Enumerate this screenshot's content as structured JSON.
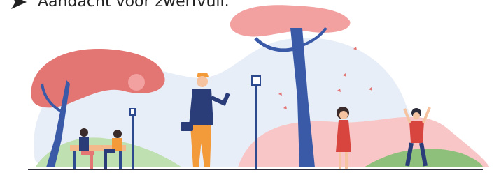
{
  "bullet": {
    "text": "Aandacht voor zwerfvuil.",
    "icon": "arrow-bullet-icon"
  },
  "illustration": {
    "subject": "park-scene",
    "colors": {
      "tree_trunk": "#3a5aa8",
      "tree_crown": "#f2a0a0",
      "tree_crown_dark": "#e37573",
      "blob_light": "#e8eef8",
      "blob_pink": "#f8c6c6",
      "grass": "#8ec07c",
      "lamp": "#2d4a8f",
      "ground_line": "#2c2c3c",
      "orange": "#f39a3b",
      "jacket": "#2b3d78"
    }
  }
}
